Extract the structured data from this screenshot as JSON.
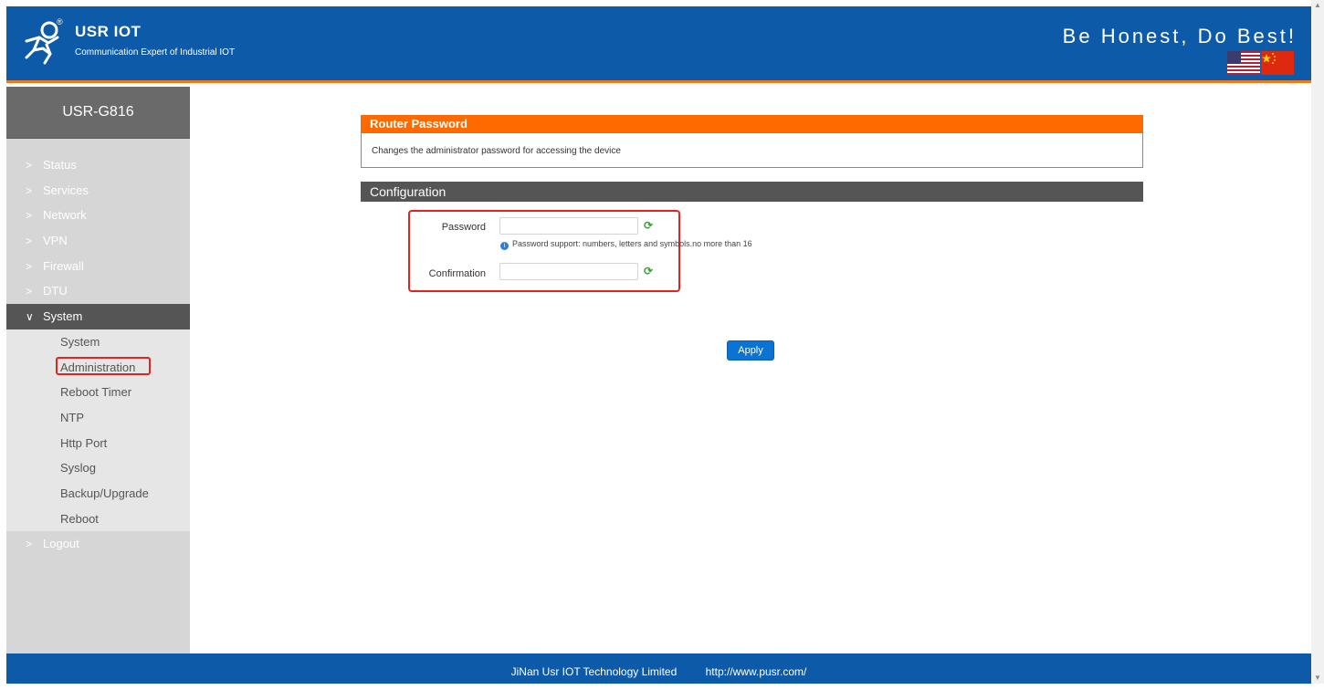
{
  "header": {
    "brand": "USR IOT",
    "registered_mark": "®",
    "subtitle": "Communication Expert of Industrial IOT",
    "slogan": "Be Honest, Do Best!"
  },
  "sidebar": {
    "model": "USR-G816",
    "items": [
      {
        "label": "Status"
      },
      {
        "label": "Services"
      },
      {
        "label": "Network"
      },
      {
        "label": "VPN"
      },
      {
        "label": "Firewall"
      },
      {
        "label": "DTU"
      },
      {
        "label": "System"
      },
      {
        "label": "Logout"
      }
    ],
    "system_sub": [
      {
        "label": "System"
      },
      {
        "label": "Administration"
      },
      {
        "label": "Reboot Timer"
      },
      {
        "label": "NTP"
      },
      {
        "label": "Http Port"
      },
      {
        "label": "Syslog"
      },
      {
        "label": "Backup/Upgrade"
      },
      {
        "label": "Reboot"
      }
    ]
  },
  "main": {
    "section_title": "Router Password",
    "section_desc": "Changes the administrator password for accessing the device",
    "config_title": "Configuration",
    "password_label": "Password",
    "password_value": "",
    "password_hint": "Password support: numbers, letters and symbols.no more than 16",
    "confirmation_label": "Confirmation",
    "confirmation_value": "",
    "apply_label": "Apply"
  },
  "footer": {
    "company": "JiNan Usr IOT Technology Limited",
    "url": "http://www.pusr.com/"
  },
  "colors": {
    "header_blue": "#0d5aa8",
    "accent_orange": "#ff6a00",
    "sidebar_gray": "#d6d6d6",
    "dark_gray": "#555555",
    "highlight_red": "#e52222"
  }
}
